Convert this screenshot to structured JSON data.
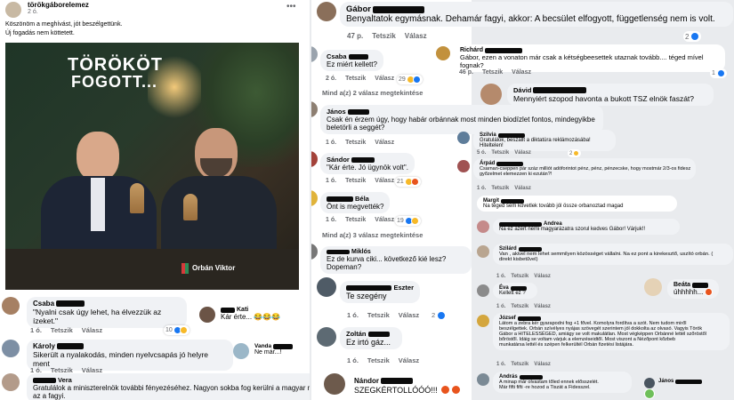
{
  "post": {
    "author": "törökgáborelemez",
    "time": "2 ó.",
    "text1": "Köszönöm a meghívást, jót beszélgettünk.",
    "text2": "Új fogadás nem köttetett.",
    "photo_title1": "TÖRÖKÖT",
    "photo_title2": "FOGOTT...",
    "photo_sign": "Orbán Viktor"
  },
  "left": [
    {
      "name": "Csaba",
      "text": "\"Nyalni csak úgy lehet, ha élvezzük az ízeket.\"",
      "time": "1 ó.",
      "like": "Tetszik",
      "reply": "Válasz",
      "count": "10"
    },
    {
      "name": "Kati",
      "text": "Kár érte... 😂😂😂"
    },
    {
      "name": "Károly",
      "text": "Sikerült a nyalakodás, minden nyelvcsapás jó helyre ment",
      "time": "1 ó.",
      "like": "Tetszik",
      "reply": "Válasz"
    },
    {
      "name": "Vanda",
      "text": "Ne már...!"
    },
    {
      "name": "Vera",
      "text1": "Gratulálok a miniszterelnök további fényezéséhez. Nagyon sokba fog kerülni a magyar népnek",
      "text2": "az a fagyi."
    }
  ],
  "middle": {
    "top": {
      "name": "Gábor",
      "text": "Benyaltatok egymásnak. Dehamár fagyi, akkor: A becsület elfogyott, függetlenség nem is volt.",
      "time": "47 p.",
      "like": "Tetszik",
      "reply": "Válasz",
      "count": "2"
    },
    "c1": {
      "name": "Csaba",
      "text": "Ez miért kellett?",
      "time": "2 ó.",
      "like": "Tetszik",
      "reply": "Válasz",
      "count": "29"
    },
    "more1": "Mind a(z) 2 válasz megtekintése",
    "c2": {
      "name": "János",
      "text1": "Csak én érzem úgy, hogy habár orbánnak most minden biodízlet fontos, mindegyikbe",
      "text2": "beletörli a seggét?",
      "time": "1 ó.",
      "like": "Tetszik",
      "reply": "Válasz"
    },
    "c3": {
      "name": "Sándor",
      "text": "\"Kár érte. Jó ügynök volt\".",
      "time": "1 ó.",
      "like": "Tetszik",
      "reply": "Válasz",
      "count": "21"
    },
    "c4": {
      "name": "Béla",
      "text": "Önt is megvették?",
      "time": "1 ó.",
      "like": "Tetszik",
      "reply": "Válasz",
      "count": "19"
    },
    "more2": "Mind a(z) 3 válasz megtekintése",
    "c5": {
      "name": "Miklós",
      "text": "Ez de kurva ciki... következő kié lesz? Dopeman?"
    },
    "c6": {
      "name": "Eszter",
      "text": "Te szegény",
      "time": "1 ó.",
      "like": "Tetszik",
      "reply": "Válasz",
      "count": "2"
    },
    "c7": {
      "name": "Zoltán",
      "text": "Ez irtó gáz...",
      "time": "1 ó.",
      "like": "Tetszik",
      "reply": "Válasz"
    },
    "c8": {
      "name": "Nándor",
      "text": "SZEGKÉRTOLLÓÓÓ!!!"
    }
  },
  "right": {
    "c1": {
      "name": "Richárd",
      "text1": "Gábor, ezen a vonaton már csak a kétségbeesettek utaznak tovább.... téged mível fognak?",
      "time": "46 p.",
      "like": "Tetszik",
      "reply": "Válasz",
      "count": "1"
    },
    "c2": {
      "name": "Dávid",
      "text": "Mennyiért szopod havonta a bukott TSZ elnök faszát?"
    },
    "c3": {
      "name": "Szilvia",
      "text": "Gratulálok, beszállt a diktatúra reklámozásába! Hiteltelen!",
      "time": "5 ó.",
      "like": "Tetszik",
      "reply": "Válasz",
      "count": "2"
    },
    "c4": {
      "name": "Árpád",
      "text1": "Csarnan-cseppen pár száz milliót adóforintot pénz, pénz, pénzecske, hogy mostmár 2/3-os fidesz",
      "text2": "győzelmet elemezzen ki ezután?!",
      "time": "1 ó.",
      "like": "Tetszik",
      "reply": "Válasz"
    },
    "c5": {
      "name": "Margit",
      "text": "Na téged sem követlek tovább jól össze orbanoztad magad"
    },
    "c6": {
      "name": "Andrea",
      "text": "Na ez azért némi magyarázatra szorul kedves Gábor! Várjuk!!"
    },
    "c7": {
      "name": "Szilárd",
      "text1": "Van , akivel nem lehet semmilyen közösséget vállalni. Na ez pont a kirekesztő, uszító orbán. (",
      "text2": "direkt kisbetűvel)",
      "time": "1 ó.",
      "like": "Tetszik",
      "reply": "Válasz"
    },
    "c8": {
      "name": "Éva",
      "text1": "Kellett ez ?",
      "time": "1 ó.",
      "like": "Tetszik",
      "reply": "Válasz"
    },
    "c9": {
      "name": "Beáta",
      "text": "úhhhhh..."
    },
    "c10": {
      "name": "József",
      "text1": "Látom a zebra kér gyarapodni fog +1 fővel. Komolyra fordítva a szót. Nem tudom miről",
      "text2": "beszélgettek. Orbán szívélyes nyájas szövegét szerintem jól dokkolta az olvasó. Vagyis Török",
      "text3": "Gábor a HITELESSÉGED, amiágy se volt makulátlan. Most végképpen Orbánné lettél szőröstől",
      "text4": "bőröstől. Idáig se voltam várjuk a elemzéseidtől. Most viszont a Nézőpont kőzbeb",
      "text5": "munkatársa lettél és szépen felkerültél Orbán fizetési listájára.",
      "time": "1 ó.",
      "like": "Tetszik",
      "reply": "Válasz"
    },
    "c11": {
      "name": "András",
      "text1": "A minap már olvastam tőled ennek elősszelét.",
      "text2": "Már fifti fifti -re hozod a Tiszát a Fidesszel.",
      "time": "1 ó."
    },
    "c12": {
      "name": "János"
    }
  }
}
